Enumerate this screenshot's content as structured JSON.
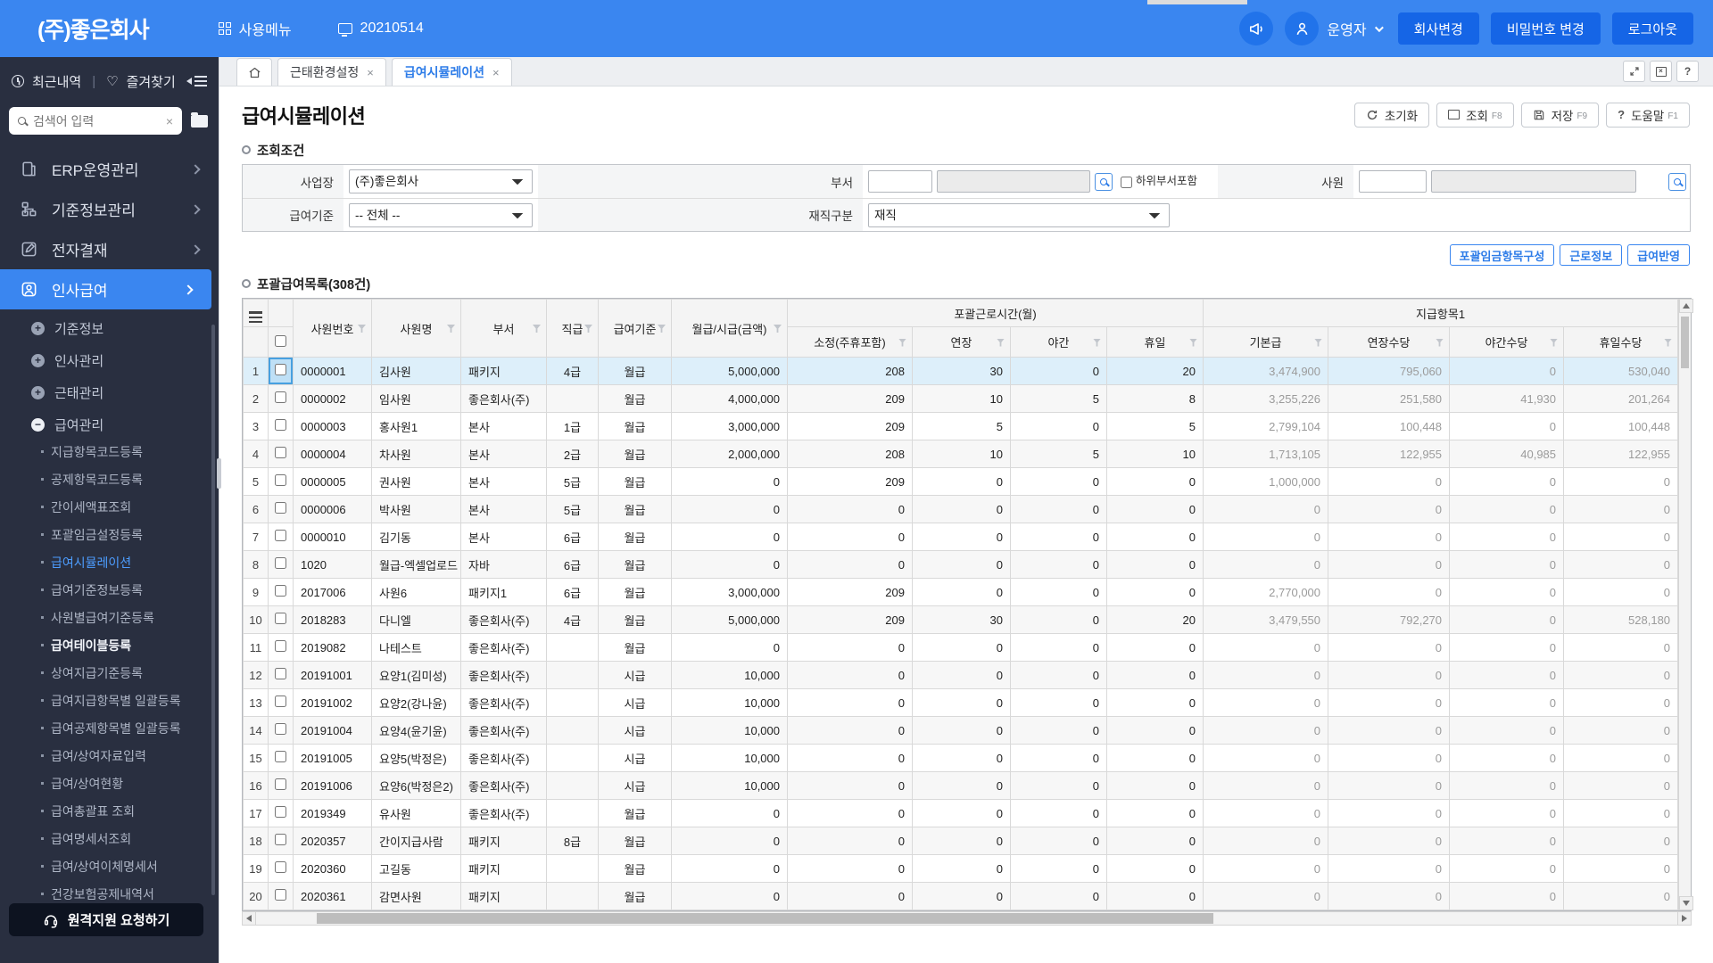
{
  "colors": {
    "accent": "#3a86f0",
    "header_button": "#1565e6",
    "active_link": "#4d9dff",
    "selected_row": "#ddeffa"
  },
  "header": {
    "logo": "(주)좋은회사",
    "usage_menu": "사용메뉴",
    "date": "20210514",
    "user": "운영자",
    "buttons": [
      "회사변경",
      "비밀번호 변경",
      "로그아웃"
    ]
  },
  "sidebar": {
    "recent": "최근내역",
    "divider": "|",
    "favorites": "즐겨찾기",
    "search_placeholder": "검색어 입력",
    "modules": [
      {
        "label": "ERP운영관리",
        "icon": "doc",
        "active": false
      },
      {
        "label": "기준정보관리",
        "icon": "sitemap",
        "active": false
      },
      {
        "label": "전자결재",
        "icon": "edit",
        "active": false
      },
      {
        "label": "인사급여",
        "icon": "person",
        "active": true
      }
    ],
    "tree": [
      {
        "label": "기준정보",
        "state": "plus"
      },
      {
        "label": "인사관리",
        "state": "plus"
      },
      {
        "label": "근태관리",
        "state": "plus"
      },
      {
        "label": "급여관리",
        "state": "minus"
      }
    ],
    "leaves": [
      {
        "label": "지급항목코드등록"
      },
      {
        "label": "공제항목코드등록"
      },
      {
        "label": "간이세액표조회"
      },
      {
        "label": "포괄임금설정등록"
      },
      {
        "label": "급여시뮬레이션",
        "active": true
      },
      {
        "label": "급여기준정보등록"
      },
      {
        "label": "사원별급여기준등록"
      },
      {
        "label": "급여테이블등록",
        "emph": true
      },
      {
        "label": "상여지급기준등록"
      },
      {
        "label": "급여지급항목별 일괄등록"
      },
      {
        "label": "급여공제항목별 일괄등록"
      },
      {
        "label": "급여/상여자료입력"
      },
      {
        "label": "급여/상여현황"
      },
      {
        "label": "급여총괄표 조회"
      },
      {
        "label": "급여명세서조회"
      },
      {
        "label": "급여/상여이체명세서"
      },
      {
        "label": "건강보험공제내역서"
      }
    ],
    "remote_button": "원격지원 요청하기"
  },
  "tabs": {
    "items": [
      {
        "label": "근태환경설정",
        "active": false
      },
      {
        "label": "급여시뮬레이션",
        "active": true
      }
    ],
    "close_glyph": "×"
  },
  "page": {
    "title": "급여시뮬레이션",
    "toolbar": [
      {
        "label": "초기화",
        "fkey": "",
        "icon": "refresh"
      },
      {
        "label": "조회",
        "fkey": "F8",
        "icon": "board"
      },
      {
        "label": "저장",
        "fkey": "F9",
        "icon": "save"
      },
      {
        "label": "도움말",
        "fkey": "F1",
        "icon": "help"
      }
    ],
    "conditions": {
      "section": "조회조건",
      "workplace_label": "사업장",
      "workplace_value": "(주)좋은회사",
      "dept_label": "부서",
      "subdept_label": "하위부서포함",
      "employee_label": "사원",
      "pay_basis_label": "급여기준",
      "pay_basis_value": "-- 전체 --",
      "status_label": "재직구분",
      "status_value": "재직"
    },
    "grid": {
      "section": "포괄급여목록(308건)",
      "actions": [
        "포괄임금항목구성",
        "근로정보",
        "급여반영"
      ],
      "left_columns": [
        "사원번호",
        "사원명",
        "부서",
        "직급",
        "급여기준",
        "월급/시급(금액)"
      ],
      "groups": [
        {
          "label": "포괄근로시간(월)",
          "children": [
            "소정(주휴포함)",
            "연장",
            "야간",
            "휴일"
          ]
        },
        {
          "label": "지급항목1",
          "children": [
            "기본급",
            "연장수당",
            "야간수당",
            "휴일수당"
          ]
        }
      ],
      "rows": [
        [
          "0000001",
          "김사원",
          "패키지",
          "4급",
          "월급",
          "5,000,000",
          "208",
          "30",
          "0",
          "20",
          "3,474,900",
          "795,060",
          "0",
          "530,040"
        ],
        [
          "0000002",
          "임사원",
          "좋은회사(주)",
          "",
          "월급",
          "4,000,000",
          "209",
          "10",
          "5",
          "8",
          "3,255,226",
          "251,580",
          "41,930",
          "201,264"
        ],
        [
          "0000003",
          "홍사원1",
          "본사",
          "1급",
          "월급",
          "3,000,000",
          "209",
          "5",
          "0",
          "5",
          "2,799,104",
          "100,448",
          "0",
          "100,448"
        ],
        [
          "0000004",
          "차사원",
          "본사",
          "2급",
          "월급",
          "2,000,000",
          "208",
          "10",
          "5",
          "10",
          "1,713,105",
          "122,955",
          "40,985",
          "122,955"
        ],
        [
          "0000005",
          "권사원",
          "본사",
          "5급",
          "월급",
          "0",
          "209",
          "0",
          "0",
          "0",
          "1,000,000",
          "0",
          "0",
          "0"
        ],
        [
          "0000006",
          "박사원",
          "본사",
          "5급",
          "월급",
          "0",
          "0",
          "0",
          "0",
          "0",
          "0",
          "0",
          "0",
          "0"
        ],
        [
          "0000010",
          "김기동",
          "본사",
          "6급",
          "월급",
          "0",
          "0",
          "0",
          "0",
          "0",
          "0",
          "0",
          "0",
          "0"
        ],
        [
          "1020",
          "월급-엑셀업로드",
          "자바",
          "6급",
          "월급",
          "0",
          "0",
          "0",
          "0",
          "0",
          "0",
          "0",
          "0",
          "0"
        ],
        [
          "2017006",
          "사원6",
          "패키지1",
          "6급",
          "월급",
          "3,000,000",
          "209",
          "0",
          "0",
          "0",
          "2,770,000",
          "0",
          "0",
          "0"
        ],
        [
          "2018283",
          "다니엘",
          "좋은회사(주)",
          "4급",
          "월급",
          "5,000,000",
          "209",
          "30",
          "0",
          "20",
          "3,479,550",
          "792,270",
          "0",
          "528,180"
        ],
        [
          "2019082",
          "나테스트",
          "좋은회사(주)",
          "",
          "월급",
          "0",
          "0",
          "0",
          "0",
          "0",
          "0",
          "0",
          "0",
          "0"
        ],
        [
          "20191001",
          "요양1(김미성)",
          "좋은회사(주)",
          "",
          "시급",
          "10,000",
          "0",
          "0",
          "0",
          "0",
          "0",
          "0",
          "0",
          "0"
        ],
        [
          "20191002",
          "요양2(강나윤)",
          "좋은회사(주)",
          "",
          "시급",
          "10,000",
          "0",
          "0",
          "0",
          "0",
          "0",
          "0",
          "0",
          "0"
        ],
        [
          "20191004",
          "요양4(윤기윤)",
          "좋은회사(주)",
          "",
          "시급",
          "10,000",
          "0",
          "0",
          "0",
          "0",
          "0",
          "0",
          "0",
          "0"
        ],
        [
          "20191005",
          "요양5(박정은)",
          "좋은회사(주)",
          "",
          "시급",
          "10,000",
          "0",
          "0",
          "0",
          "0",
          "0",
          "0",
          "0",
          "0"
        ],
        [
          "20191006",
          "요양6(박정은2)",
          "좋은회사(주)",
          "",
          "시급",
          "10,000",
          "0",
          "0",
          "0",
          "0",
          "0",
          "0",
          "0",
          "0"
        ],
        [
          "2019349",
          "유사원",
          "좋은회사(주)",
          "",
          "월급",
          "0",
          "0",
          "0",
          "0",
          "0",
          "0",
          "0",
          "0",
          "0"
        ],
        [
          "2020357",
          "간이지급사람",
          "패키지",
          "8급",
          "월급",
          "0",
          "0",
          "0",
          "0",
          "0",
          "0",
          "0",
          "0",
          "0"
        ],
        [
          "2020360",
          "고길동",
          "패키지",
          "",
          "월급",
          "0",
          "0",
          "0",
          "0",
          "0",
          "0",
          "0",
          "0",
          "0"
        ],
        [
          "2020361",
          "감면사원",
          "패키지",
          "",
          "월급",
          "0",
          "0",
          "0",
          "0",
          "0",
          "0",
          "0",
          "0",
          "0"
        ]
      ]
    }
  }
}
